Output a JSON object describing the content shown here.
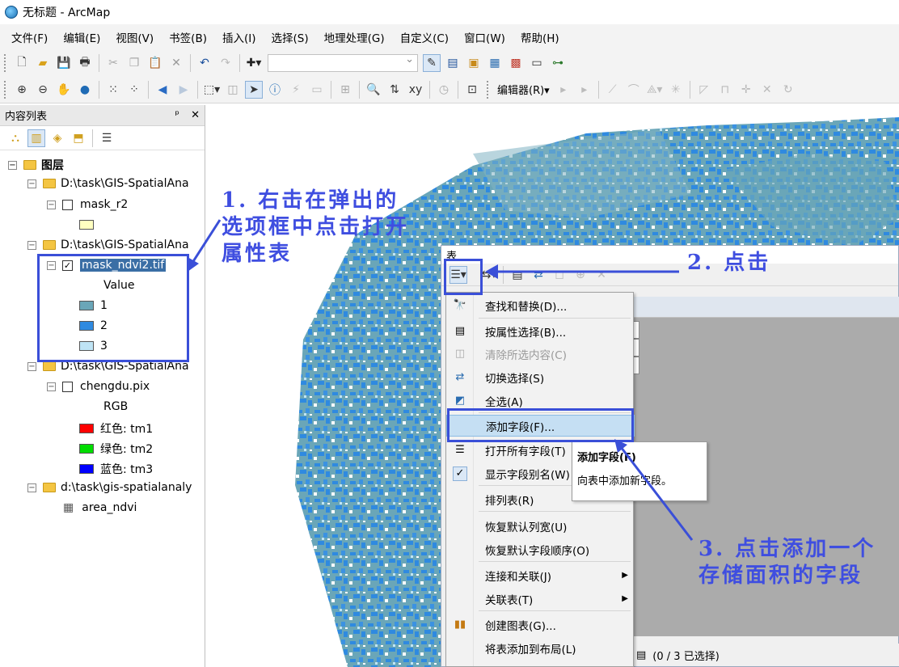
{
  "window": {
    "title": "无标题 - ArcMap"
  },
  "menu": [
    "文件(F)",
    "编辑(E)",
    "视图(V)",
    "书签(B)",
    "插入(I)",
    "选择(S)",
    "地理处理(G)",
    "自定义(C)",
    "窗口(W)",
    "帮助(H)"
  ],
  "toolbar": {
    "editor_label": "编辑器(R)▾"
  },
  "toc": {
    "title": "内容列表",
    "pin": "ᵖ",
    "close": "✕",
    "root": "图层",
    "items": [
      {
        "label": "D:\\task\\GIS-SpatialAna"
      },
      {
        "label": "mask_r2"
      },
      {
        "label": "D:\\task\\GIS-SpatialAna"
      },
      {
        "label": "mask_ndvi2.tif"
      },
      {
        "label": "Value"
      },
      {
        "label": "1",
        "color": "#6aa6b8"
      },
      {
        "label": "2",
        "color": "#2f8ae0"
      },
      {
        "label": "3",
        "color": "#bfe4f5"
      },
      {
        "label": "D:\\task\\GIS-SpatialAna"
      },
      {
        "label": "chengdu.pix"
      },
      {
        "label": "RGB"
      },
      {
        "label": "红色:   tm1",
        "color": "#ff0000"
      },
      {
        "label": "绿色: tm2",
        "color": "#00dd00"
      },
      {
        "label": "蓝色:   tm3",
        "color": "#0000ff"
      },
      {
        "label": "d:\\task\\gis-spatialanaly"
      },
      {
        "label": "area_ndvi"
      }
    ]
  },
  "table_window": {
    "title": "表",
    "status": "(0 / 3 已选择)"
  },
  "context_menu": {
    "items": [
      {
        "label": "查找和替换(D)...",
        "icon": "binoculars-icon",
        "enabled": true
      },
      {
        "label": "按属性选择(B)...",
        "icon": "select-by-attributes-icon",
        "enabled": true
      },
      {
        "label": "清除所选内容(C)",
        "icon": "clear-selection-icon",
        "enabled": false
      },
      {
        "label": "切换选择(S)",
        "icon": "switch-selection-icon",
        "enabled": true
      },
      {
        "label": "全选(A)",
        "icon": "select-all-icon",
        "enabled": true
      },
      {
        "label": "添加字段(F)...",
        "icon": "",
        "enabled": true,
        "highlighted": true
      },
      {
        "label": "打开所有字段(T)",
        "icon": "fields-icon",
        "enabled": true
      },
      {
        "label": "显示字段别名(W)",
        "icon": "check-icon",
        "enabled": true
      },
      {
        "label": "排列表(R)",
        "icon": "",
        "enabled": true
      },
      {
        "label": "恢复默认列宽(U)",
        "icon": "",
        "enabled": true
      },
      {
        "label": "恢复默认字段顺序(O)",
        "icon": "",
        "enabled": true
      },
      {
        "label": "连接和关联(J)",
        "icon": "",
        "enabled": true,
        "submenu": true
      },
      {
        "label": "关联表(T)",
        "icon": "",
        "enabled": true,
        "submenu": true
      },
      {
        "label": "创建图表(G)...",
        "icon": "chart-icon",
        "enabled": true
      },
      {
        "label": "将表添加到布局(L)",
        "icon": "",
        "enabled": true
      }
    ]
  },
  "tooltip": {
    "title": "添加字段(F)",
    "description": "向表中添加新字段。"
  },
  "annotations": [
    {
      "lines": [
        "1. 右击在弹出的",
        "选项框中点击打开",
        "属性表"
      ]
    },
    {
      "lines": [
        "2. 点击"
      ]
    },
    {
      "lines": [
        "3. 点击添加一个",
        "存储面积的字段"
      ]
    }
  ],
  "colors": {
    "annotation": "#3a4fd8",
    "ndvi_1": "#6aa6b8",
    "ndvi_2": "#2f8ae0",
    "ndvi_3": "#bfe4f5"
  }
}
